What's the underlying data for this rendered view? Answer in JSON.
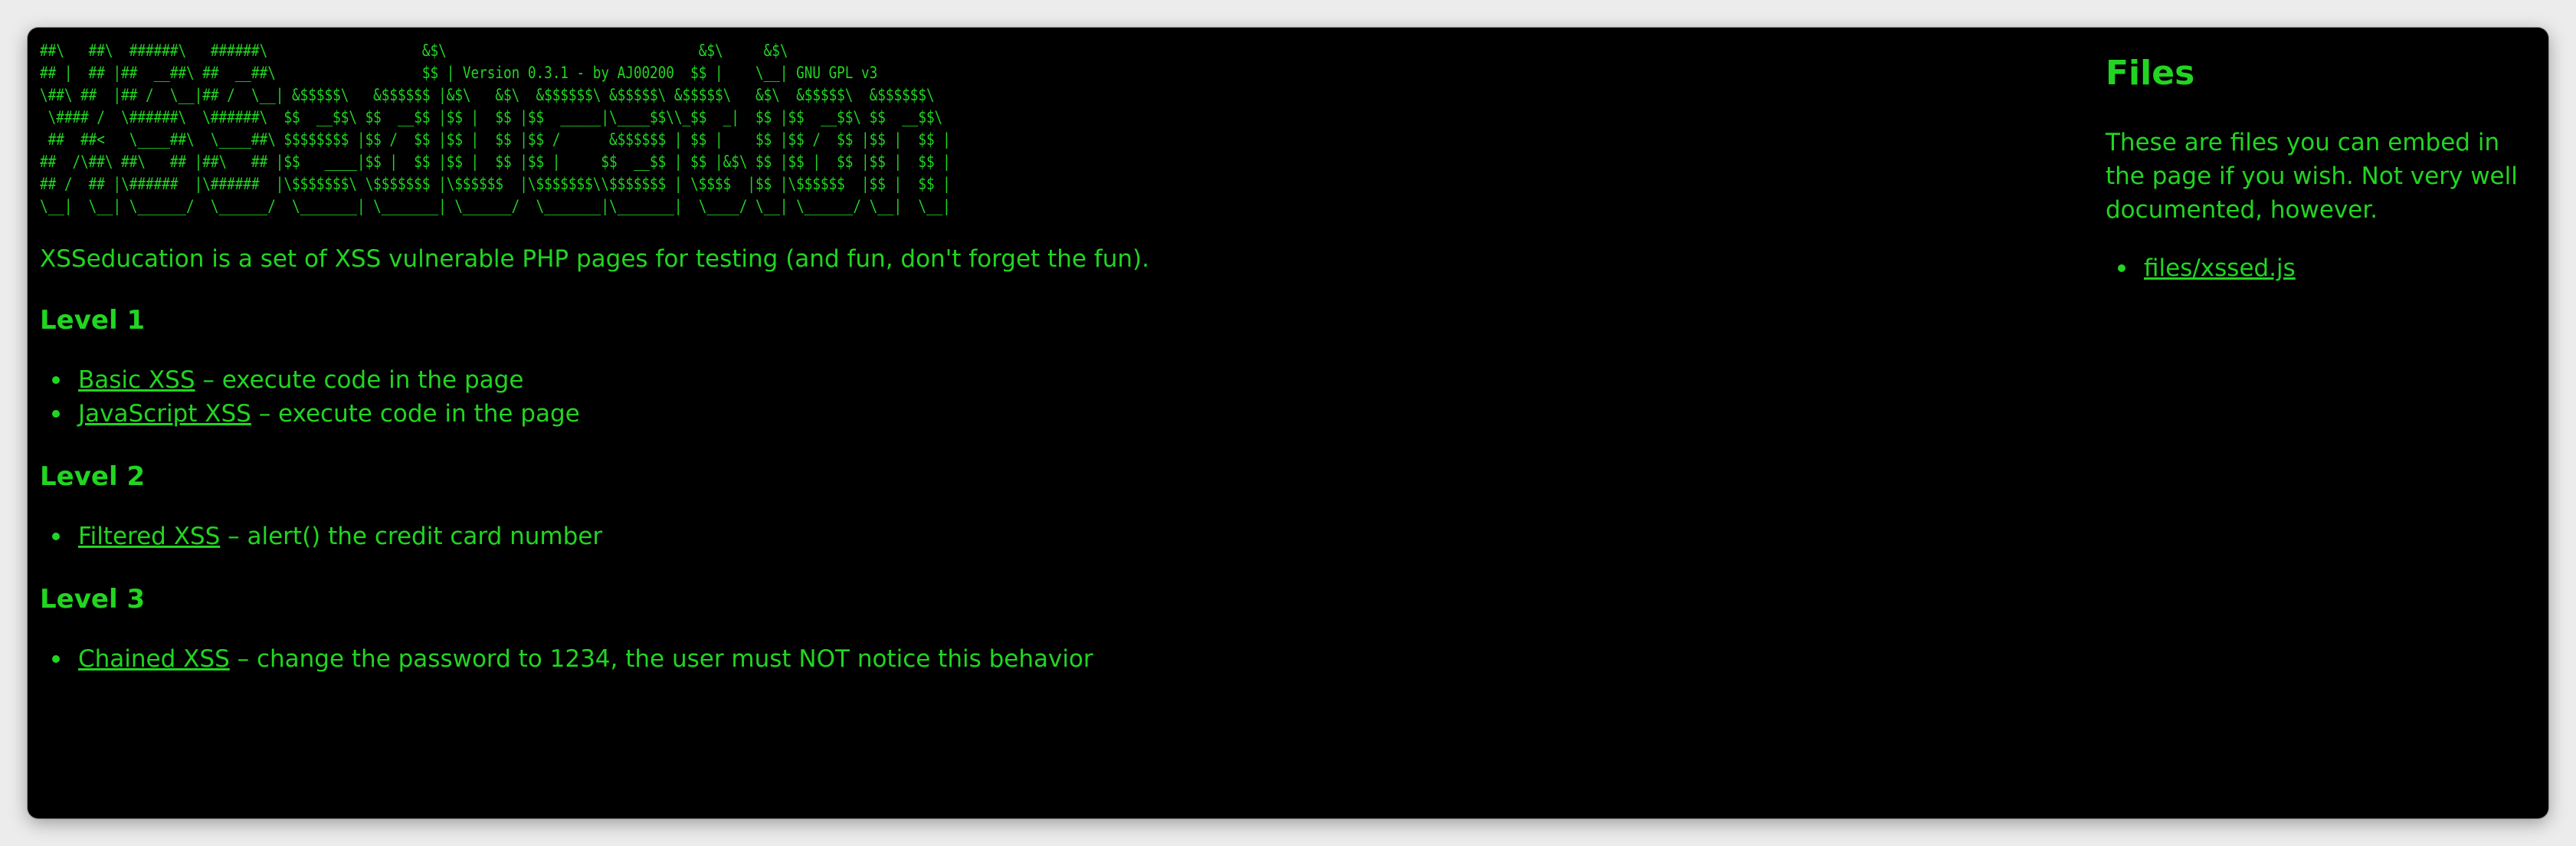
{
  "banner": {
    "ascii_lines": [
      "##\\   ##\\  ######\\   ######\\                   &$\\                               &$\\     &$\\",
      "## |  ## |##  __##\\ ##  __##\\                  $$ | Version 0.3.1 - by AJ00200  $$ |    \\__| GNU GPL v3",
      "\\##\\ ##  |## /  \\__|## /  \\__| &$$$$$\\   &$$$$$$ |&$\\   &$\\  &$$$$$$\\ &$$$$$\\ &$$$$$\\   &$\\  &$$$$$\\  &$$$$$$\\",
      " \\#### /  \\######\\  \\######\\  $$  __$$\\ $$  __$$ |$$ |  $$ |$$  _____|\\____$$\\\\_$$  _|  $$ |$$  __$$\\ $$  __$$\\",
      " ##  ##<   \\____##\\  \\____##\\ $$$$$$$$ |$$ /  $$ |$$ |  $$ |$$ /      &$$$$$$ | $$ |    $$ |$$ /  $$ |$$ |  $$ |",
      "##  /\\##\\ ##\\   ## |##\\   ## |$$   ____|$$ |  $$ |$$ |  $$ |$$ |     $$  __$$ | $$ |&$\\ $$ |$$ |  $$ |$$ |  $$ |",
      "## /  ## |\\######  |\\######  |\\$$$$$$$\\ \\$$$$$$$ |\\$$$$$$  |\\$$$$$$$\\\\$$$$$$$ | \\$$$$  |$$ |\\$$$$$$  |$$ |  $$ |",
      "\\__|  \\__| \\______/  \\______/  \\_______| \\_______| \\______/  \\_______|\\_______|  \\____/ \\__| \\______/ \\__|  \\__|"
    ]
  },
  "intro": "XSSeducation is a set of XSS vulnerable PHP pages for testing (and fun, don't forget the fun).",
  "levels": [
    {
      "title": "Level 1",
      "items": [
        {
          "link": "Basic XSS",
          "desc": " – execute code in the page"
        },
        {
          "link": "JavaScript XSS",
          "desc": " – execute code in the page"
        }
      ]
    },
    {
      "title": "Level 2",
      "items": [
        {
          "link": "Filtered XSS",
          "desc": " – alert() the credit card number"
        }
      ]
    },
    {
      "title": "Level 3",
      "items": [
        {
          "link": "Chained XSS",
          "desc": " – change the password to 1234, the user must NOT notice this behavior"
        }
      ]
    }
  ],
  "sidebar": {
    "title": "Files",
    "description": "These are files you can embed in the page if you wish. Not very well documented, however.",
    "files": [
      "files/xssed.js"
    ]
  },
  "colors": {
    "background": "#000000",
    "text": "#22d522"
  }
}
